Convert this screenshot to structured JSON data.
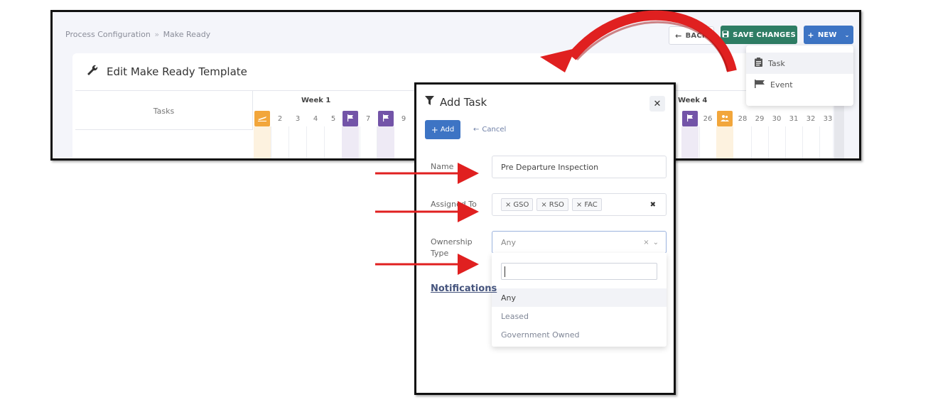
{
  "breadcrumb": {
    "parent": "Process Configuration",
    "separator": "»",
    "current": "Make Ready"
  },
  "toolbar": {
    "back_label": "BACK",
    "save_label": "SAVE CHANGES",
    "new_label": "NEW"
  },
  "new_menu": {
    "items": [
      {
        "label": "Task",
        "icon": "clipboard-icon"
      },
      {
        "label": "Event",
        "icon": "flag-icon"
      }
    ]
  },
  "template_card": {
    "title": "Edit Make Ready Template",
    "icon": "wrench-icon"
  },
  "schedule": {
    "tasks_header": "Tasks",
    "weeks": [
      {
        "label": "Week 1"
      },
      {
        "label": "Week 4"
      }
    ],
    "week1_days": [
      {
        "label": "1",
        "badge": "orange",
        "icon": "plane-icon"
      },
      {
        "label": "2"
      },
      {
        "label": "3"
      },
      {
        "label": "4"
      },
      {
        "label": "5"
      },
      {
        "label": "6",
        "badge": "purple",
        "icon": "flag-icon"
      },
      {
        "label": "7"
      },
      {
        "label": "8",
        "badge": "purple",
        "icon": "flag-icon"
      },
      {
        "label": "9"
      }
    ],
    "week4_days": [
      {
        "label": "25",
        "badge": "purple",
        "icon": "flag-icon"
      },
      {
        "label": "26"
      },
      {
        "label": "27",
        "badge": "orange",
        "icon": "users-icon"
      },
      {
        "label": "28"
      },
      {
        "label": "29"
      },
      {
        "label": "30"
      },
      {
        "label": "31"
      },
      {
        "label": "32"
      },
      {
        "label": "33"
      }
    ]
  },
  "modal": {
    "title": "Add Task",
    "add_label": "Add",
    "cancel_label": "Cancel",
    "fields": {
      "name_label": "Name",
      "name_value": "Pre Departure Inspection",
      "assigned_label": "Assigned To",
      "assigned_tags": [
        "GSO",
        "RSO",
        "FAC"
      ],
      "ownership_label_line1": "Ownership",
      "ownership_label_line2": "Type",
      "ownership_value": "Any"
    },
    "ownership_options": [
      "Any",
      "Leased",
      "Government Owned"
    ],
    "notifications_label": "Notifications"
  },
  "colors": {
    "save_button": "#2e7d64",
    "primary_button": "#3d74c4",
    "badge_orange": "#f2a63b",
    "badge_purple": "#7354a8",
    "arrow_red": "#e02020"
  }
}
